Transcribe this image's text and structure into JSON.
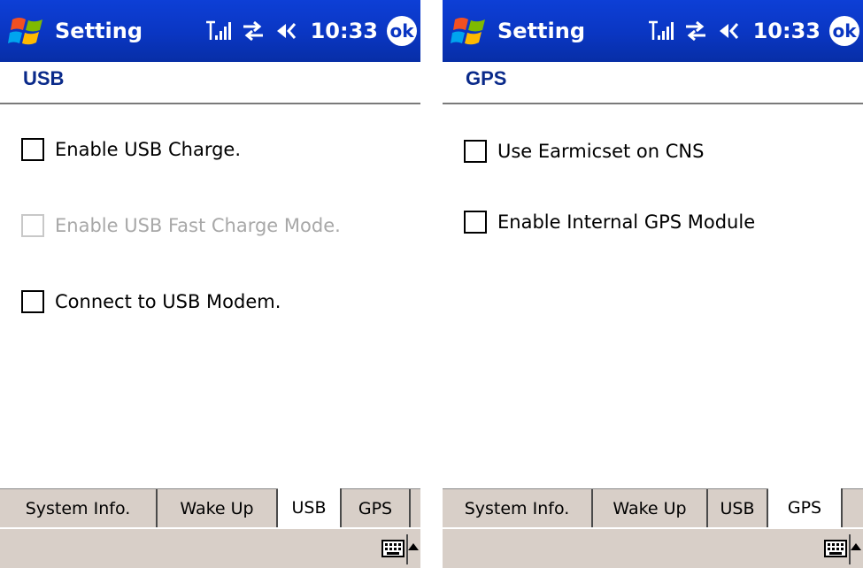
{
  "screens": [
    {
      "titlebar": {
        "title": "Setting",
        "time": "10:33",
        "ok_label": "ok"
      },
      "page_title": "USB",
      "options": [
        {
          "label": "Enable USB Charge.",
          "checked": false,
          "enabled": true
        },
        {
          "label": "Enable USB Fast Charge Mode.",
          "checked": false,
          "enabled": false
        },
        {
          "label": "Connect to USB Modem.",
          "checked": false,
          "enabled": true
        }
      ],
      "tabs": [
        {
          "label": "System Info.",
          "active": false
        },
        {
          "label": "Wake Up",
          "active": false
        },
        {
          "label": "USB",
          "active": true
        },
        {
          "label": "GPS",
          "active": false
        }
      ]
    },
    {
      "titlebar": {
        "title": "Setting",
        "time": "10:33",
        "ok_label": "ok"
      },
      "page_title": "GPS",
      "options": [
        {
          "label": "Use Earmicset on CNS",
          "checked": false,
          "enabled": true
        },
        {
          "label": "Enable Internal GPS Module",
          "checked": false,
          "enabled": true
        }
      ],
      "tabs": [
        {
          "label": "System Info.",
          "active": false
        },
        {
          "label": "Wake Up",
          "active": false
        },
        {
          "label": "USB",
          "active": false
        },
        {
          "label": "GPS",
          "active": true
        }
      ]
    }
  ],
  "icons": {
    "start": "windows-start-icon",
    "signal": "signal-strength-icon",
    "connectivity": "connectivity-icon",
    "volume": "speaker-volume-icon",
    "keyboard": "keyboard-icon",
    "sip_arrow": "up-arrow-icon"
  },
  "colors": {
    "titlebar": "#0a36c2",
    "header_text": "#0a2a8a",
    "tab_background": "#d8cfc8",
    "disabled_text": "#a8a8a8"
  }
}
